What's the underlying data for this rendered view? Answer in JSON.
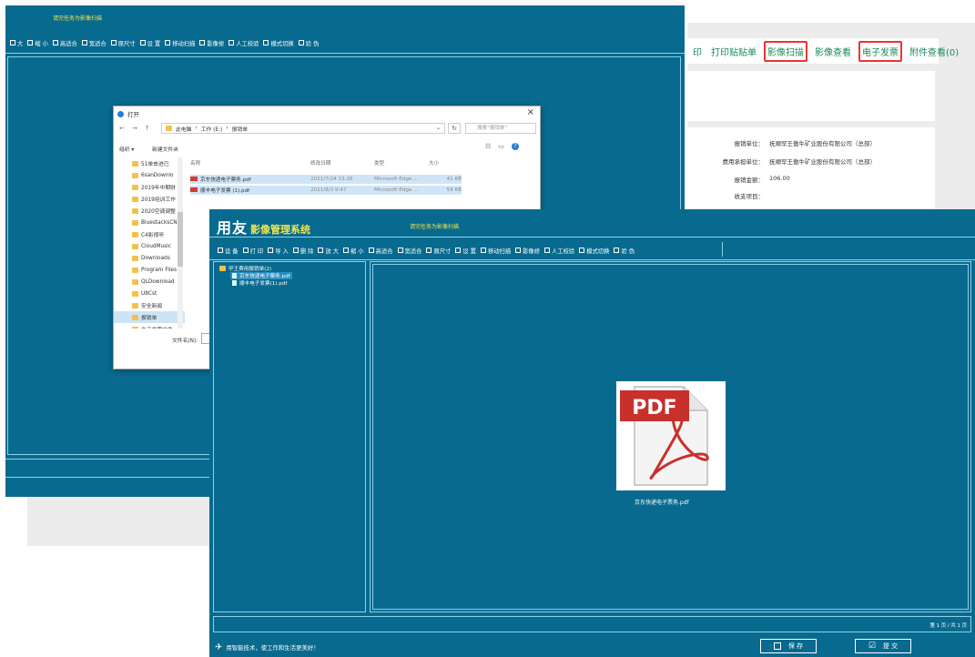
{
  "back_window": {
    "title": "请完任务为影像扫描",
    "toolbar": [
      {
        "icon": "zoom-in-icon",
        "label": "大"
      },
      {
        "icon": "zoom-out-icon",
        "label": "缩 小"
      },
      {
        "icon": "fit-height-icon",
        "label": "高适合"
      },
      {
        "icon": "fit-width-icon",
        "label": "宽适合"
      },
      {
        "icon": "original-size-icon",
        "label": "原尺寸"
      },
      {
        "icon": "settings-icon",
        "label": "设 置"
      },
      {
        "icon": "mobile-scan-icon",
        "label": "移动扫描"
      },
      {
        "icon": "image-fix-icon",
        "label": "影像修"
      },
      {
        "icon": "manual-check-icon",
        "label": "人工校验"
      },
      {
        "icon": "mode-switch-icon",
        "label": "模式切换"
      },
      {
        "icon": "verify-icon",
        "label": "验 伪"
      }
    ]
  },
  "web_form": {
    "links": [
      {
        "label": "印",
        "highlight": false
      },
      {
        "label": "打印贴贴单",
        "highlight": false
      },
      {
        "label": "影像扫描",
        "highlight": true
      },
      {
        "label": "影像查看",
        "highlight": false
      },
      {
        "label": "电子发票",
        "highlight": true
      },
      {
        "label": "附件查看(0)",
        "highlight": false
      }
    ],
    "fields": [
      {
        "key": "报销单位：",
        "value": "抚顺罕王傲牛矿业股份有限公司（总部）"
      },
      {
        "key": "费用承担单位：",
        "value": "抚顺罕王傲牛矿业股份有限公司（总部）"
      },
      {
        "key": "报销金额：",
        "value": "106.00"
      },
      {
        "key": "收支项目：",
        "value": ""
      }
    ]
  },
  "open_dialog": {
    "title": "打开",
    "breadcrumb": [
      "此电脑",
      "工作 (E:)",
      "报销单"
    ],
    "search_placeholder": "搜索\"报销单\"",
    "organize_label": "组织 ▾",
    "new_folder_label": "新建文件夹",
    "columns": [
      "名称",
      "修改日期",
      "类型",
      "大小"
    ],
    "nav_items": [
      "51单击进已",
      "6sanDownlo",
      "2019年中期财",
      "2019培训工作",
      "2020空调调整",
      "BluestacksCN",
      "C4影视听",
      "CloudMusic",
      "Downloads",
      "Program Files",
      "QLDownload",
      "U8Cst",
      "安全新闻",
      "报销单",
      "电子发票文件"
    ],
    "selected_nav_index": 13,
    "files": [
      {
        "name": "京东快递电子票务.pdf",
        "date": "2021/7/24 13:26",
        "type": "Microsoft Edge ...",
        "size": "41 KB"
      },
      {
        "name": "顺丰电子发票 (1).pdf",
        "date": "2021/8/3 9:47",
        "type": "Microsoft Edge ...",
        "size": "59 KB"
      }
    ],
    "filename_label": "文件名(N):"
  },
  "app": {
    "logo": "用友",
    "system_name": "影像管理系统",
    "task_title": "请完任务为影像扫描",
    "toolbar": [
      {
        "icon": "device-icon",
        "label": "设 备"
      },
      {
        "icon": "print-icon",
        "label": "打 印"
      },
      {
        "icon": "import-icon",
        "label": "导 入"
      },
      {
        "icon": "delete-icon",
        "label": "删 除"
      },
      {
        "icon": "zoom-in-icon",
        "label": "放 大"
      },
      {
        "icon": "zoom-out-icon",
        "label": "缩 小"
      },
      {
        "icon": "fit-height-icon",
        "label": "高适合"
      },
      {
        "icon": "fit-width-icon",
        "label": "宽适合"
      },
      {
        "icon": "original-size-icon",
        "label": "原尺寸"
      },
      {
        "icon": "settings-icon",
        "label": "设 置"
      },
      {
        "icon": "mobile-scan-icon",
        "label": "移动扫描"
      },
      {
        "icon": "image-fix-icon",
        "label": "影像修"
      },
      {
        "icon": "manual-check-icon",
        "label": "人工校验"
      },
      {
        "icon": "mode-switch-icon",
        "label": "模式切换"
      },
      {
        "icon": "verify-icon",
        "label": "验 伪"
      }
    ],
    "tree_root": "罕王费用报销单(2)",
    "tree_items": [
      "京东快递电子票务.pdf",
      "顺丰电子发票(1).pdf"
    ],
    "preview_badge": "PDF",
    "preview_filename": "京东快递电子票务.pdf",
    "page_info": "第 1 页 / 共 1 页",
    "slogan": "用智能技术，使工作和生活更美好！",
    "save_label": "保 存",
    "submit_label": "提 交"
  },
  "colors": {
    "app_bg": "#086a8e",
    "accent_yellow": "#f4e54b",
    "highlight_red": "#e33333",
    "link_green": "#1a8a5a",
    "pdf_red": "#c8302c"
  }
}
